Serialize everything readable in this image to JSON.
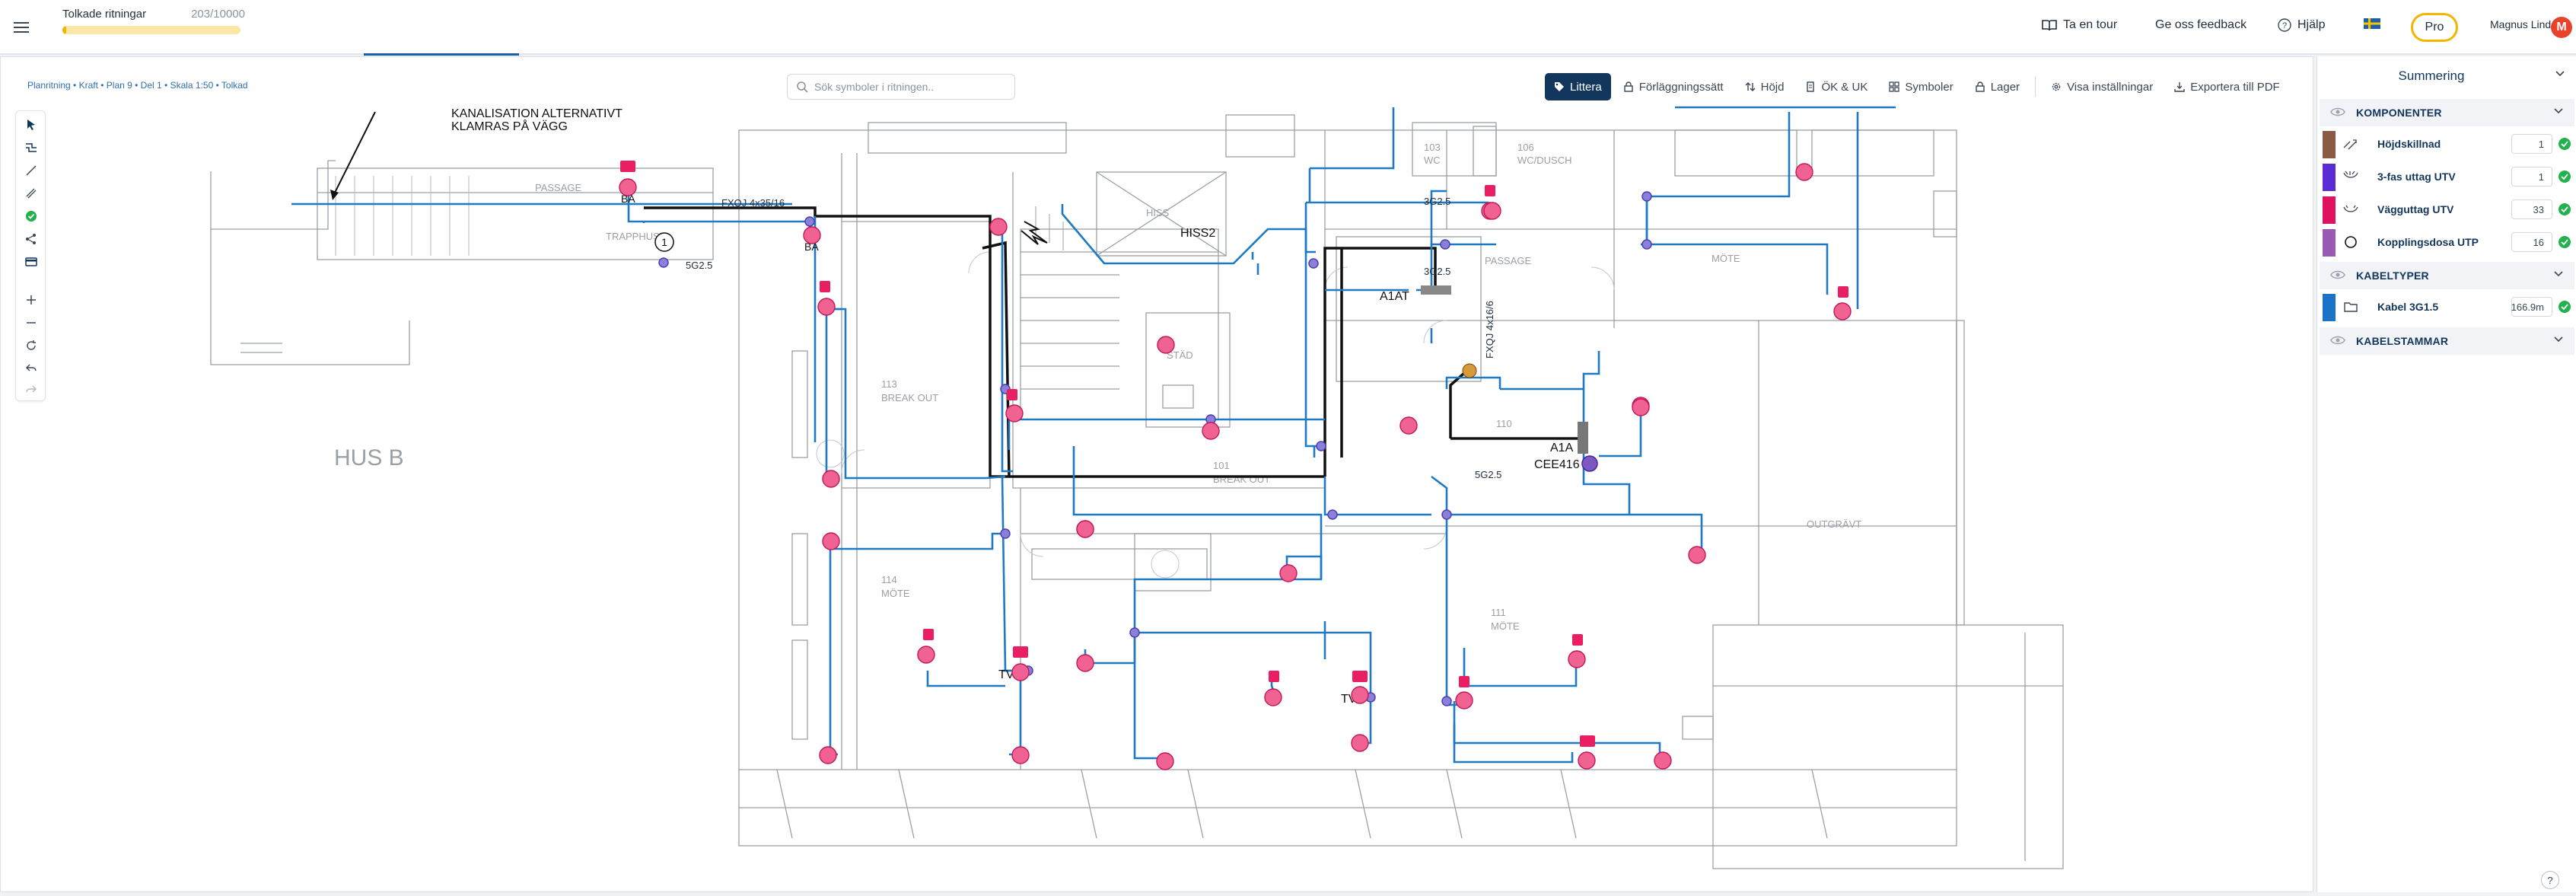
{
  "header": {
    "progress_label": "Tolkade ritningar",
    "progress_count": "203/10000",
    "progress_fraction": 0.0203,
    "tour": "Ta en tour",
    "feedback": "Ge oss feedback",
    "help": "Hjälp",
    "pro": "Pro",
    "user_name": "Magnus Lind",
    "user_initial": "M"
  },
  "breadcrumb": "Planritning • Kraft • Plan 9 • Del 1 • Skala 1:50 • Tolkad",
  "search": {
    "placeholder": "Sök symboler i ritningen.."
  },
  "toolbar": {
    "littera": "Littera",
    "forlaggning": "Förläggningssätt",
    "hojd": "Höjd",
    "ok_uk": "ÖK & UK",
    "symboler": "Symboler",
    "lager": "Lager",
    "visa": "Visa inställningar",
    "export": "Exportera till PDF"
  },
  "sidebar": {
    "title": "Summering",
    "komponenter": {
      "label": "KOMPONENTER",
      "items": [
        {
          "label": "Höjdskillnad",
          "qty": "1",
          "color": "#8a5a44"
        },
        {
          "label": "3-fas uttag UTV",
          "qty": "1",
          "color": "#5b2bd8"
        },
        {
          "label": "Vägguttag UTV",
          "qty": "33",
          "color": "#e0115f"
        },
        {
          "label": "Kopplingsdosa UTP",
          "qty": "16",
          "color": "#9b59b6"
        }
      ]
    },
    "kabeltyper": {
      "label": "KABELTYPER",
      "items": [
        {
          "label": "Kabel 3G1.5",
          "qty": "166.9m",
          "color": "#1a73c8"
        }
      ]
    },
    "kabelstammar": {
      "label": "KABELSTAMMAR"
    }
  },
  "plan": {
    "note_line1": "KANALISATION ALTERNATIVT",
    "note_line2": "KLAMRAS PÅ VÄGG",
    "hus": "HUS B",
    "rooms": {
      "passage": "PASSAGE",
      "trapphus": "TRAPPHUS",
      "r113": "113",
      "break_out": "BREAK OUT",
      "r101": "101",
      "break_out2": "BREAK OUT",
      "r114": "114",
      "mote": "MÖTE",
      "r111": "111",
      "mote2": "MÖTE",
      "mote3": "MÖTE",
      "r103": "103",
      "wc": "WC",
      "r106": "106",
      "wc_dusch": "WC/DUSCH",
      "hiss": "HISS",
      "stad": "STÄD",
      "passage2": "PASSAGE",
      "outgravt": "OUTGRÄVT",
      "r110": "110"
    },
    "labels": {
      "ba": "BA",
      "ba2": "BA",
      "fxqj": "FXQJ 4x35/16",
      "fxqj_v": "FXQJ 4x16/6",
      "sg25a": "5G2.5",
      "sg25b": "3G2.5",
      "sg25c": "3G2.5",
      "sg25d": "5G2.5",
      "hiss2": "HISS2",
      "a1at": "A1AT",
      "a1a": "A1A",
      "cee": "CEE416",
      "tv1": "TV",
      "tv2": "TV",
      "one": "1"
    }
  }
}
